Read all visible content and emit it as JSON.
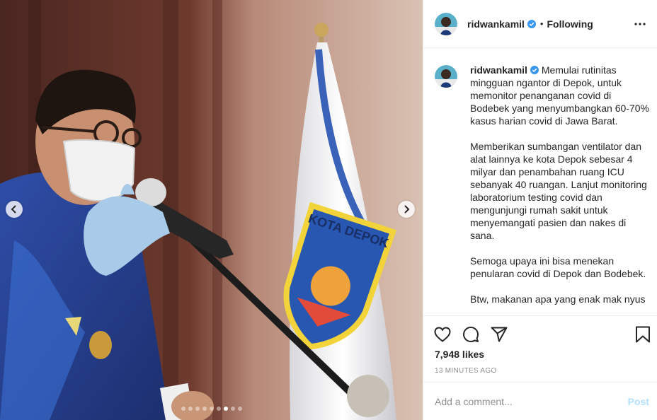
{
  "header": {
    "username": "ridwankamil",
    "separator": "•",
    "follow_status": "Following"
  },
  "caption": {
    "username": "ridwankamil",
    "paragraphs": [
      "Memulai rutinitas mingguan ngantor di Depok, untuk memonitor penanganan covid di Bodebek yang menyumbangkan 60-70% kasus harian covid di Jawa Barat.",
      "Memberikan sumbangan ventilator dan alat lainnya ke kota Depok sebesar 4 milyar dan penambahan ruang ICU sebanyak 40 ruangan. Lanjut monitoring laboratorium testing covid dan mengunjungi rumah sakit untuk menyemangati pasien dan nakes di sana.",
      "Semoga upaya ini bisa menekan penularan covid di Depok dan Bodebek.",
      "Btw, makanan apa yang enak mak nyus"
    ]
  },
  "engagement": {
    "likes": "7,948 likes",
    "timestamp": "13 MINUTES AGO"
  },
  "comment_box": {
    "placeholder": "Add a comment...",
    "post_label": "Post"
  },
  "media": {
    "flag_text": "KOTA DEPOK",
    "carousel_total": 9,
    "carousel_active_index": 6
  },
  "colors": {
    "verified_blue": "#3897f0",
    "post_button_disabled": "#b2dffc",
    "meta_gray": "#8e8e8e",
    "border": "#efefef"
  },
  "icons": [
    "chevron-left-icon",
    "chevron-right-icon",
    "verified-badge-icon",
    "more-options-icon",
    "heart-icon",
    "comment-icon",
    "share-icon",
    "bookmark-icon"
  ]
}
